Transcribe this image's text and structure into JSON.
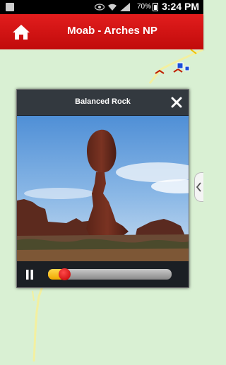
{
  "status_bar": {
    "time": "3:24 PM",
    "battery_percent": "70%",
    "icons": [
      "mail-icon",
      "eye-icon",
      "wifi-icon",
      "signal-icon",
      "battery-icon"
    ]
  },
  "header": {
    "title": "Moab - Arches NP",
    "home_icon": "home-icon",
    "background_color": "#d01212"
  },
  "map": {
    "background_color": "#d9f0d3",
    "trail_color": "#f3f0a0"
  },
  "popup": {
    "title": "Balanced Rock",
    "close_icon": "close-icon",
    "photo_subject": "balanced-rock-photo",
    "player": {
      "pause_icon": "pause-icon",
      "progress_fraction": 0.13
    }
  },
  "side_panel_tab": {
    "icon": "chevron-left-icon"
  }
}
